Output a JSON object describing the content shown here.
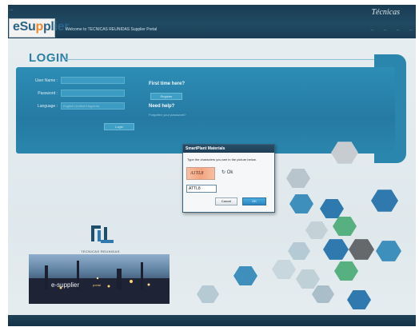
{
  "header": {
    "tiny_top": "...",
    "logo": {
      "left": "eSu",
      "accent": "p",
      "right": "plier"
    },
    "welcome": "Welcome to TECNICAS REUNIDAS Supplier Portal",
    "brand_right": "Técnicas",
    "links": [
      "...",
      "...",
      "...",
      "..."
    ]
  },
  "login": {
    "title": "LOGIN",
    "user_name_label": "User Name :",
    "password_label": "Password :",
    "language_label": "Language :",
    "language_value": "English (United Kingdom)",
    "login_button": "Login",
    "first_time": "First time here?",
    "register_button": "Register",
    "need_help": "Need help?",
    "help_text": "Forgotten your password?"
  },
  "branding": {
    "company": "TECNICAS REUNIDAS",
    "photo_text": "e-supplier",
    "photo_sub": "portal"
  },
  "dialog": {
    "title": "SmartPlant Materials",
    "message": "Type the characters you see in the picture below.",
    "captcha_text": "A1TL8",
    "refresh_icon": "↻",
    "refresh_label": "Ok",
    "input_value": "ATTL8",
    "cancel_button": "Cancel",
    "ok_button": "OK"
  },
  "colors": {
    "panel": "#2a86ad",
    "accent": "#2b80a4",
    "header": "#1a3c52"
  }
}
